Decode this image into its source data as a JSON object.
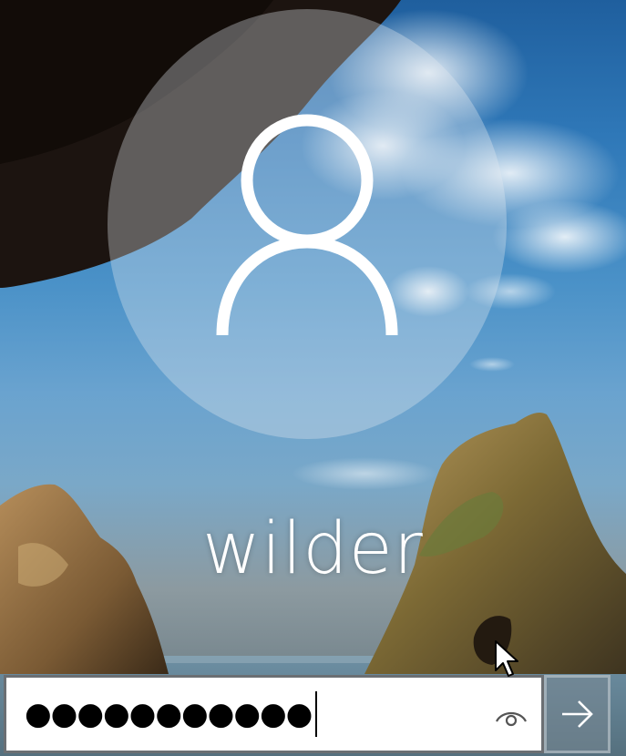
{
  "user": {
    "name": "wilder",
    "avatar_icon": "user-icon"
  },
  "password": {
    "masked_value": "●●●●●●●●●●●",
    "reveal_icon": "eye-icon"
  },
  "submit": {
    "icon": "arrow-right-icon"
  },
  "colors": {
    "sky": "#2f78b8",
    "rock": "#8a6a3a",
    "field_border": "#6b6f73"
  }
}
